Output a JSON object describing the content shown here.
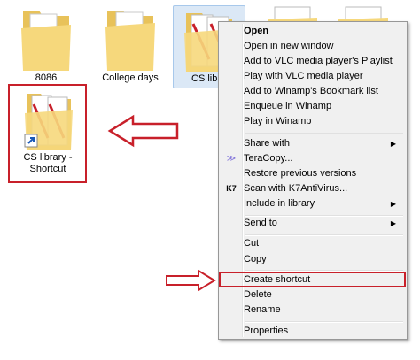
{
  "folders": [
    {
      "label": "8086"
    },
    {
      "label": "College days"
    },
    {
      "label": "CS libra"
    },
    {
      "label": ""
    },
    {
      "label": ""
    }
  ],
  "shortcut": {
    "line1": "CS library -",
    "line2": "Shortcut"
  },
  "menu": {
    "open": "Open",
    "open_new_window": "Open in new window",
    "add_vlc_playlist": "Add to VLC media player's Playlist",
    "play_vlc": "Play with VLC media player",
    "add_winamp_bookmark": "Add to Winamp's Bookmark list",
    "enqueue_winamp": "Enqueue in Winamp",
    "play_winamp": "Play in Winamp",
    "share_with": "Share with",
    "teracopy": "TeraCopy...",
    "restore_versions": "Restore previous versions",
    "scan_k7": "Scan with K7AntiVirus...",
    "include_library": "Include in library",
    "send_to": "Send to",
    "cut": "Cut",
    "copy": "Copy",
    "create_shortcut": "Create shortcut",
    "delete": "Delete",
    "rename": "Rename",
    "properties": "Properties"
  },
  "icons": {
    "k7": "K7",
    "teracopy": "teracopy-icon",
    "submenu": "submenu-arrow-icon"
  },
  "colors": {
    "highlight_border": "#c8202a",
    "folder": "#f6d87c"
  }
}
